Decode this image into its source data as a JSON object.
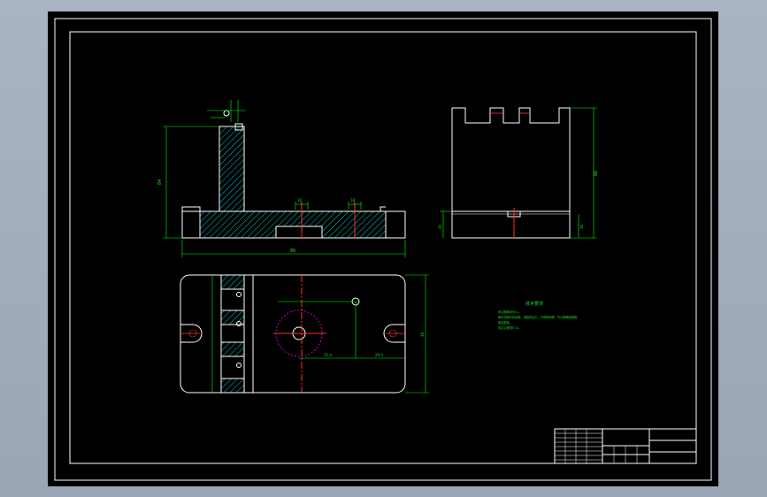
{
  "colors": {
    "background": "#000000",
    "outline": "#ffffff",
    "dimension": "#00ff00",
    "centerline": "#ff3030",
    "hatch": "#00ffff",
    "hidden_circle": "#cc00cc"
  },
  "front_view": {
    "dims": [
      "84",
      "86",
      "10",
      "18"
    ]
  },
  "side_view": {
    "dims": [
      "86",
      "20",
      "16"
    ]
  },
  "top_view": {
    "dims": [
      "25.4",
      "29.4",
      "38"
    ]
  },
  "notes": {
    "title": "技术要求",
    "lines": [
      "未注倒角均为C1。",
      "铸件须经时效处理，消除内应力，不得有砂眼、气孔等铸造缺陷。",
      "锐边倒钝。",
      "未注公差按IT14。"
    ]
  }
}
